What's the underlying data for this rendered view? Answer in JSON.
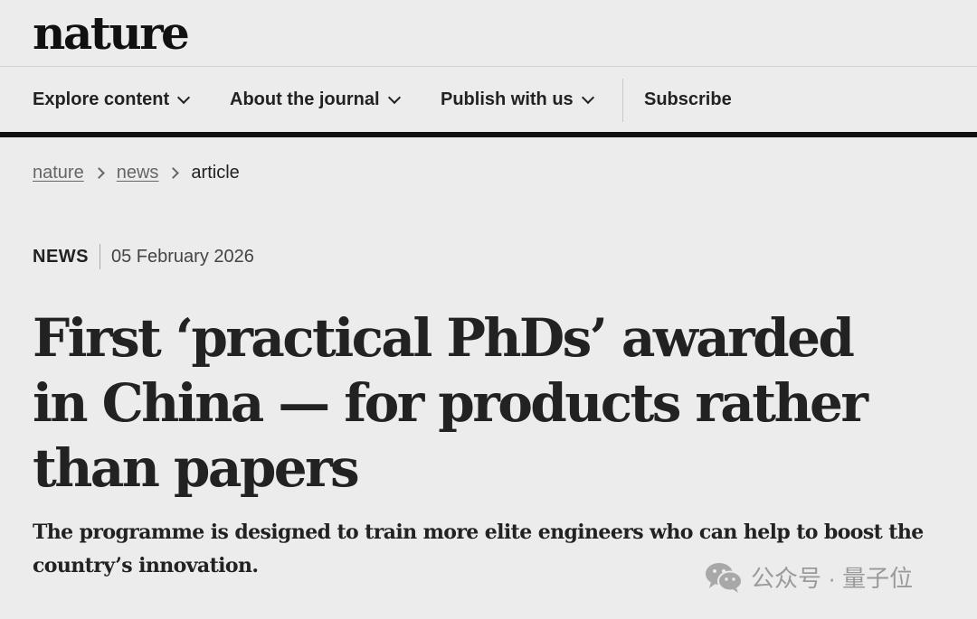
{
  "header": {
    "logo": "nature"
  },
  "nav": {
    "items": [
      {
        "label": "Explore content"
      },
      {
        "label": "About the journal"
      },
      {
        "label": "Publish with us"
      }
    ],
    "subscribe_label": "Subscribe"
  },
  "breadcrumb": {
    "items": [
      {
        "label": "nature"
      },
      {
        "label": "news"
      }
    ],
    "current": "article"
  },
  "article": {
    "type": "NEWS",
    "date": "05 February 2026",
    "title": "First ‘practical PhDs’ awarded in China — for products rather than papers",
    "standfirst": "The programme is designed to train more elite engineers who can help to boost the country’s innovation."
  },
  "watermark": {
    "text": "公众号 · 量子位",
    "icon": "wechat-icon"
  }
}
